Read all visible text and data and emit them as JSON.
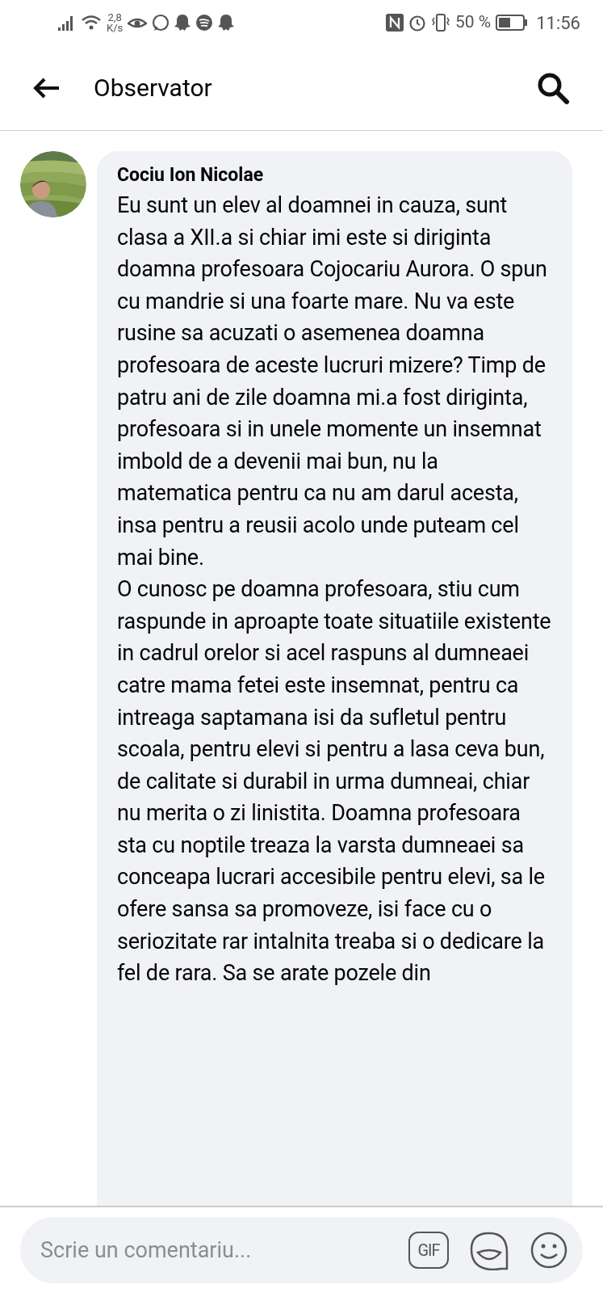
{
  "status_bar": {
    "speed_value": "2,8",
    "speed_unit": "K/s",
    "battery_text": "50 %",
    "time": "11:56"
  },
  "header": {
    "title": "Observator"
  },
  "comment": {
    "author": "Cociu Ion Nicolae",
    "paragraphs": [
      "Eu sunt un elev al doamnei in cauza, sunt clasa a XII.a si chiar imi este si diriginta doamna profesoara Cojocariu Aurora. O spun cu mandrie si una foarte mare. Nu va este rusine sa acuzati o asemenea doamna profesoara de aceste lucruri mizere? Timp de patru ani de zile doamna mi.a fost diriginta, profesoara si in unele momente un insemnat imbold de a devenii mai bun, nu la matematica pentru ca nu am darul acesta, insa pentru a reusii acolo unde puteam cel mai bine.",
      "O cunosc pe doamna profesoara, stiu cum raspunde in aproapte toate situatiile existente in cadrul orelor si acel raspuns al dumneaei catre mama fetei este insemnat, pentru ca intreaga saptamana isi da sufletul pentru scoala, pentru elevi si pentru a lasa ceva bun, de calitate si durabil in urma dumneai, chiar nu merita o zi linistita. Doamna profesoara sta cu noptile treaza la varsta dumneaei sa conceapa lucrari accesibile pentru elevi, sa le ofere sansa sa promoveze, isi face cu o seriozitate rar intalnita treaba si o dedicare la fel de rara. Sa se arate pozele din"
    ]
  },
  "composer": {
    "placeholder": "Scrie un comentariu...",
    "gif_label": "GIF"
  }
}
